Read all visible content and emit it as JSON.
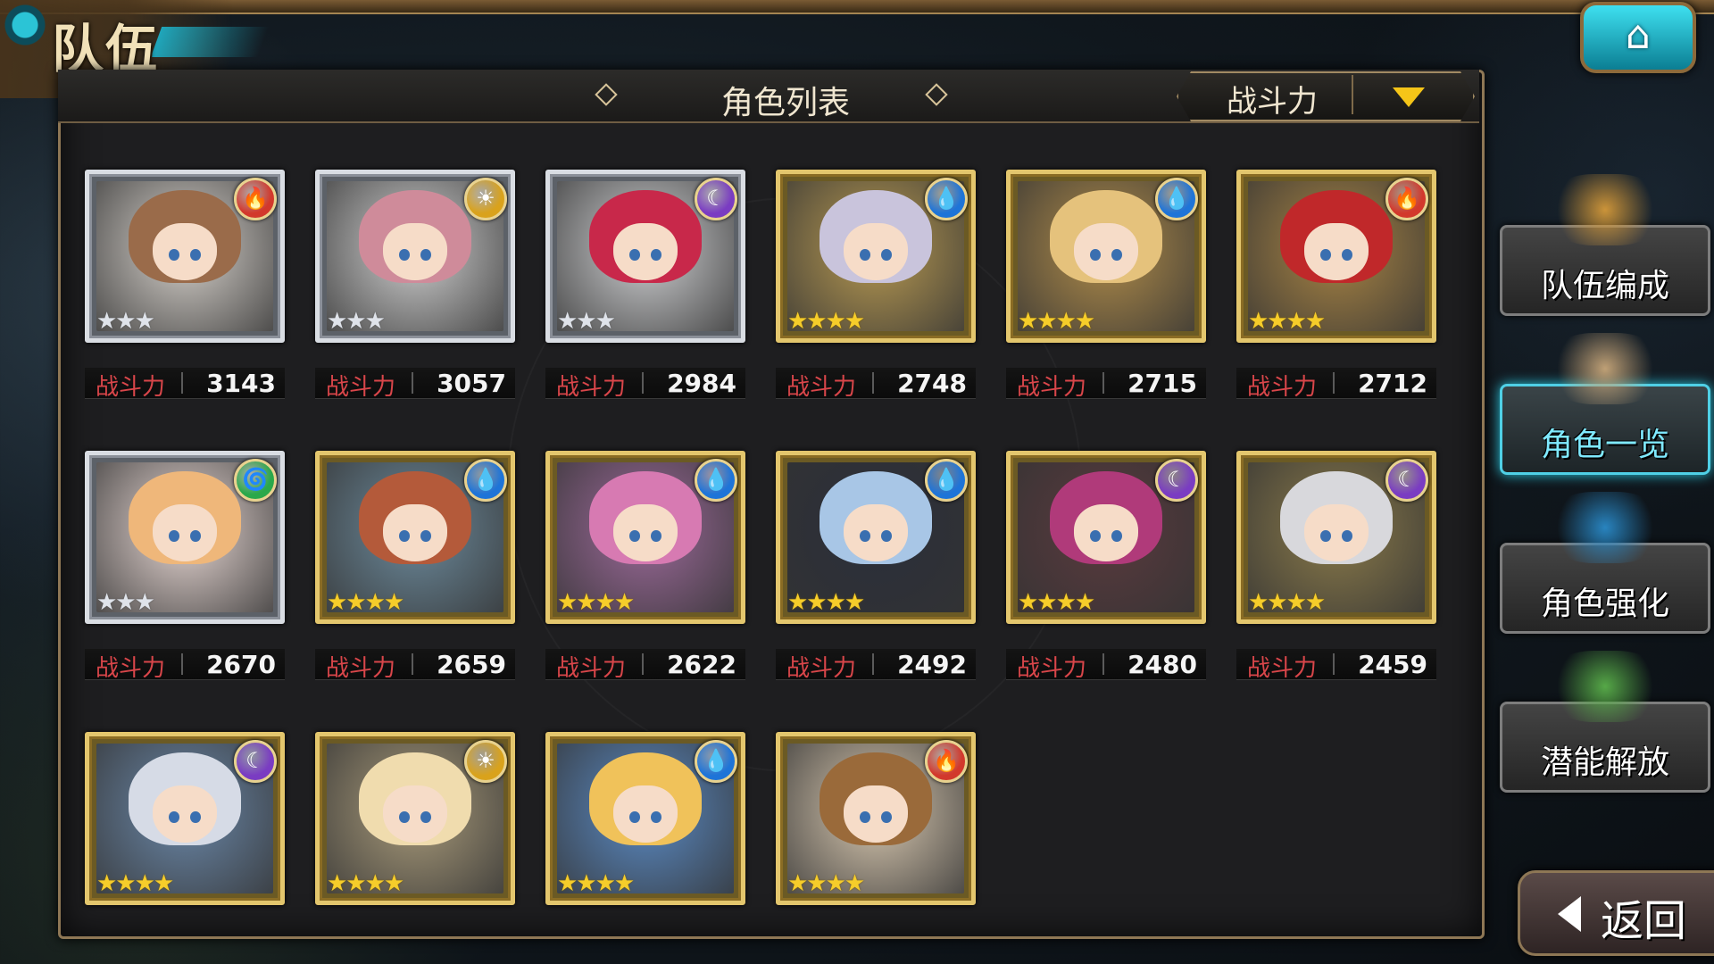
{
  "screen_title": "队伍",
  "panel_title": "角色列表",
  "sort": {
    "label": "战斗力"
  },
  "power_label": "战斗力",
  "side_menu": [
    {
      "label": "队伍编成",
      "active": false
    },
    {
      "label": "角色一览",
      "active": true
    },
    {
      "label": "角色强化",
      "active": false
    },
    {
      "label": "潜能解放",
      "active": false
    }
  ],
  "back_label": "返回",
  "colors": {
    "fire": "#d2382c",
    "water": "#1e74d8",
    "dark": "#7a3cc2",
    "light": "#d9a21c",
    "wind": "#2aa84a",
    "active_accent": "#4fd0e6"
  },
  "characters": [
    {
      "element": "fire",
      "stars": 3,
      "rarity": "silver",
      "power": "3143",
      "hair": "#9a6b4a",
      "bg": "#d7d2cc"
    },
    {
      "element": "light",
      "stars": 3,
      "rarity": "silver",
      "power": "3057",
      "hair": "#cf8b9a",
      "bg": "#cfcfcf"
    },
    {
      "element": "dark",
      "stars": 3,
      "rarity": "silver",
      "power": "2984",
      "hair": "#c8284a",
      "bg": "#cfd0d2"
    },
    {
      "element": "water",
      "stars": 4,
      "rarity": "gold",
      "power": "2748",
      "hair": "#c9c4dc",
      "bg": "#b89a52"
    },
    {
      "element": "water",
      "stars": 4,
      "rarity": "gold",
      "power": "2715",
      "hair": "#e5c27c",
      "bg": "#b08c4a"
    },
    {
      "element": "fire",
      "stars": 4,
      "rarity": "gold",
      "power": "2712",
      "hair": "#c0282a",
      "bg": "#a88444"
    },
    {
      "element": "wind",
      "stars": 3,
      "rarity": "silver",
      "power": "2670",
      "hair": "#efb77a",
      "bg": "#e8d8d4"
    },
    {
      "element": "water",
      "stars": 4,
      "rarity": "gold",
      "power": "2659",
      "hair": "#b45a3a",
      "bg": "#6c8a9c"
    },
    {
      "element": "water",
      "stars": 4,
      "rarity": "gold",
      "power": "2622",
      "hair": "#d77ab2",
      "bg": "#9c6a9a"
    },
    {
      "element": "water",
      "stars": 4,
      "rarity": "gold",
      "power": "2492",
      "hair": "#a8c6e6",
      "bg": "#2a2e3a"
    },
    {
      "element": "dark",
      "stars": 4,
      "rarity": "gold",
      "power": "2480",
      "hair": "#b03a7a",
      "bg": "#5a3a3e"
    },
    {
      "element": "dark",
      "stars": 4,
      "rarity": "gold",
      "power": "2459",
      "hair": "#d8d8dc",
      "bg": "#8a7a4a"
    },
    {
      "element": "dark",
      "stars": 4,
      "rarity": "gold",
      "power": "",
      "hair": "#d6dbe6",
      "bg": "#6a87a8"
    },
    {
      "element": "light",
      "stars": 4,
      "rarity": "gold",
      "power": "",
      "hair": "#f0dcae",
      "bg": "#a89a7a"
    },
    {
      "element": "water",
      "stars": 4,
      "rarity": "gold",
      "power": "",
      "hair": "#f0c25a",
      "bg": "#5a8ac4"
    },
    {
      "element": "fire",
      "stars": 4,
      "rarity": "gold",
      "power": "",
      "hair": "#9a6a3a",
      "bg": "#d8c8b0"
    }
  ]
}
